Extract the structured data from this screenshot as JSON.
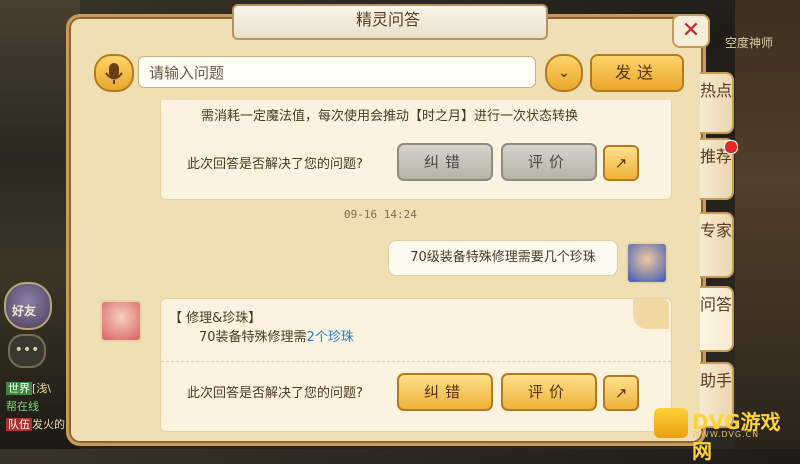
{
  "window": {
    "title": "精灵问答",
    "close_label": "✕"
  },
  "game": {
    "top_right_label": "空度神师",
    "friend_label": "好友",
    "chat_lines": [
      {
        "tag": "世界",
        "text": "[浅\\",
        "tag_color": "#3a8a3a"
      },
      {
        "tag": "",
        "text": "帮在线",
        "tag_color": ""
      },
      {
        "tag": "队伍",
        "text": "发火的",
        "tag_color": "#b03030"
      }
    ]
  },
  "search": {
    "placeholder": "请输入问题",
    "value": ""
  },
  "buttons": {
    "send": "发送",
    "dropdown": "⌄"
  },
  "conversation": {
    "card1": {
      "partial_text": "需消耗一定魔法值，每次使用会推动【时之月】进行一次状态转换",
      "prompt": "此次回答是否解决了您的问题?",
      "correct": "纠错",
      "rate": "评价"
    },
    "timestamp": "09-16 14:24",
    "user_question": "70级装备特殊修理需要几个珍珠",
    "answer": {
      "title": "【 修理&珍珠】",
      "body_prefix": "70装备特殊修理需",
      "body_highlight": "2个珍珠",
      "prompt": "此次回答是否解决了您的问题?",
      "correct": "纠错",
      "rate": "评价"
    }
  },
  "side_tabs": [
    {
      "label": "热点"
    },
    {
      "label": "推荐"
    },
    {
      "label": "专家"
    },
    {
      "label": "问答"
    },
    {
      "label": "助手"
    }
  ],
  "watermark": {
    "brand": "DVG游戏网",
    "sub": "WWW.DVG.CN"
  },
  "colors": {
    "accent": "#efb23a",
    "highlight": "#2a7ac8",
    "close": "#c8222a"
  }
}
